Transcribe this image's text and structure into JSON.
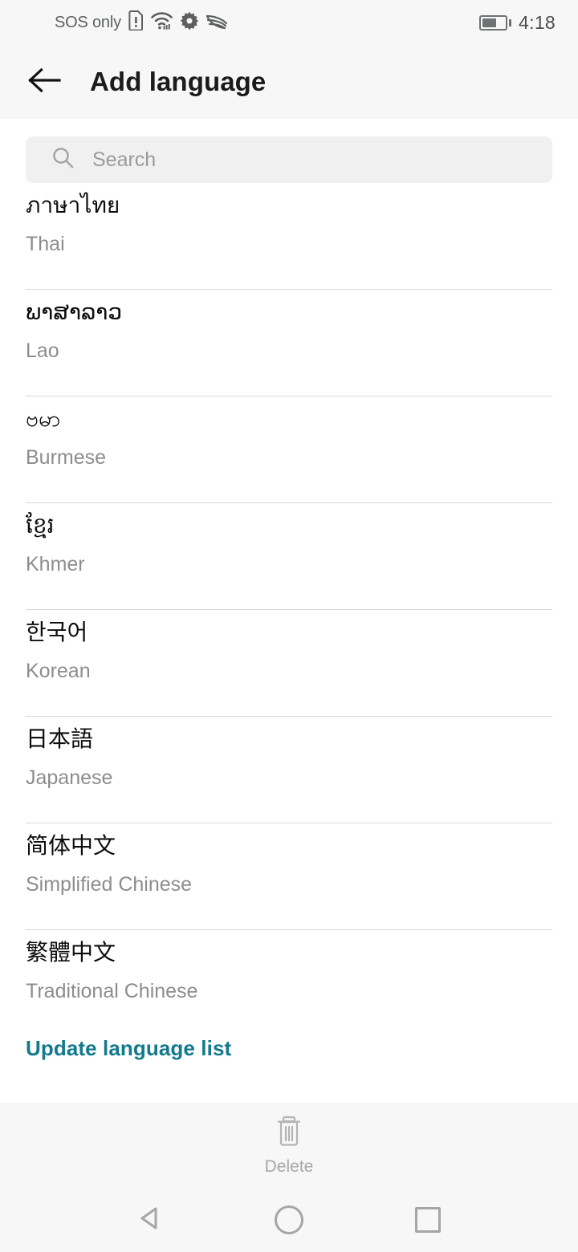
{
  "status_bar": {
    "carrier": "SOS only",
    "time": "4:18",
    "battery_percent": 62,
    "icons": [
      "sim-card-alert-icon",
      "wifi-4g-icon",
      "gear-icon",
      "data-saver-icon",
      "battery-icon"
    ]
  },
  "app_bar": {
    "back_icon": "back-arrow-icon",
    "title": "Add language"
  },
  "search": {
    "icon": "search-icon",
    "placeholder": "Search",
    "value": ""
  },
  "languages": [
    {
      "native": "ภาษาไทย",
      "english": "Thai"
    },
    {
      "native": "ພາສາລາວ",
      "english": "Lao"
    },
    {
      "native": "ဗမာ",
      "english": "Burmese"
    },
    {
      "native": "ខ្មែរ",
      "english": "Khmer"
    },
    {
      "native": "한국어",
      "english": "Korean"
    },
    {
      "native": "日本語",
      "english": "Japanese"
    },
    {
      "native": "简体中文",
      "english": "Simplified Chinese"
    },
    {
      "native": "繁體中文",
      "english": "Traditional Chinese"
    }
  ],
  "update": {
    "label": "Update language list"
  },
  "delete_bar": {
    "icon": "trash-icon",
    "label": "Delete"
  },
  "nav_bar": {
    "back_label": "back-triangle-icon",
    "home_label": "home-circle-icon",
    "recents_label": "recents-square-icon"
  },
  "colors": {
    "accent_teal": "#13798c",
    "header_bg": "#f7f7f7",
    "search_bg": "#f0f0f0",
    "divider": "#d7d9d9",
    "primary_text": "#0d0d0d",
    "secondary_text": "#8d8d8d"
  }
}
